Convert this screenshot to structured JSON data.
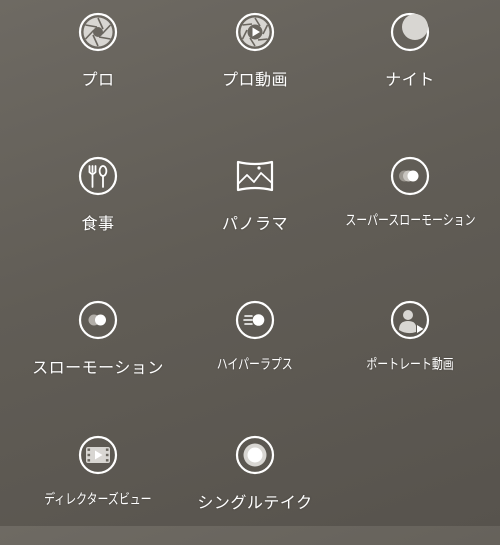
{
  "modes": [
    {
      "label": "プロ",
      "icon": "pro-aperture-icon"
    },
    {
      "label": "プロ動画",
      "icon": "pro-video-icon"
    },
    {
      "label": "ナイト",
      "icon": "night-moon-icon"
    },
    {
      "label": "食事",
      "icon": "food-fork-spoon-icon"
    },
    {
      "label": "パノラマ",
      "icon": "panorama-icon"
    },
    {
      "label": "スーパースローモーション",
      "icon": "super-slow-motion-icon"
    },
    {
      "label": "スローモーション",
      "icon": "slow-motion-icon"
    },
    {
      "label": "ハイパーラプス",
      "icon": "hyperlapse-icon"
    },
    {
      "label": "ポートレート動画",
      "icon": "portrait-video-icon"
    },
    {
      "label": "ディレクターズビュー",
      "icon": "directors-view-icon"
    },
    {
      "label": "シングルテイク",
      "icon": "single-take-icon"
    }
  ]
}
